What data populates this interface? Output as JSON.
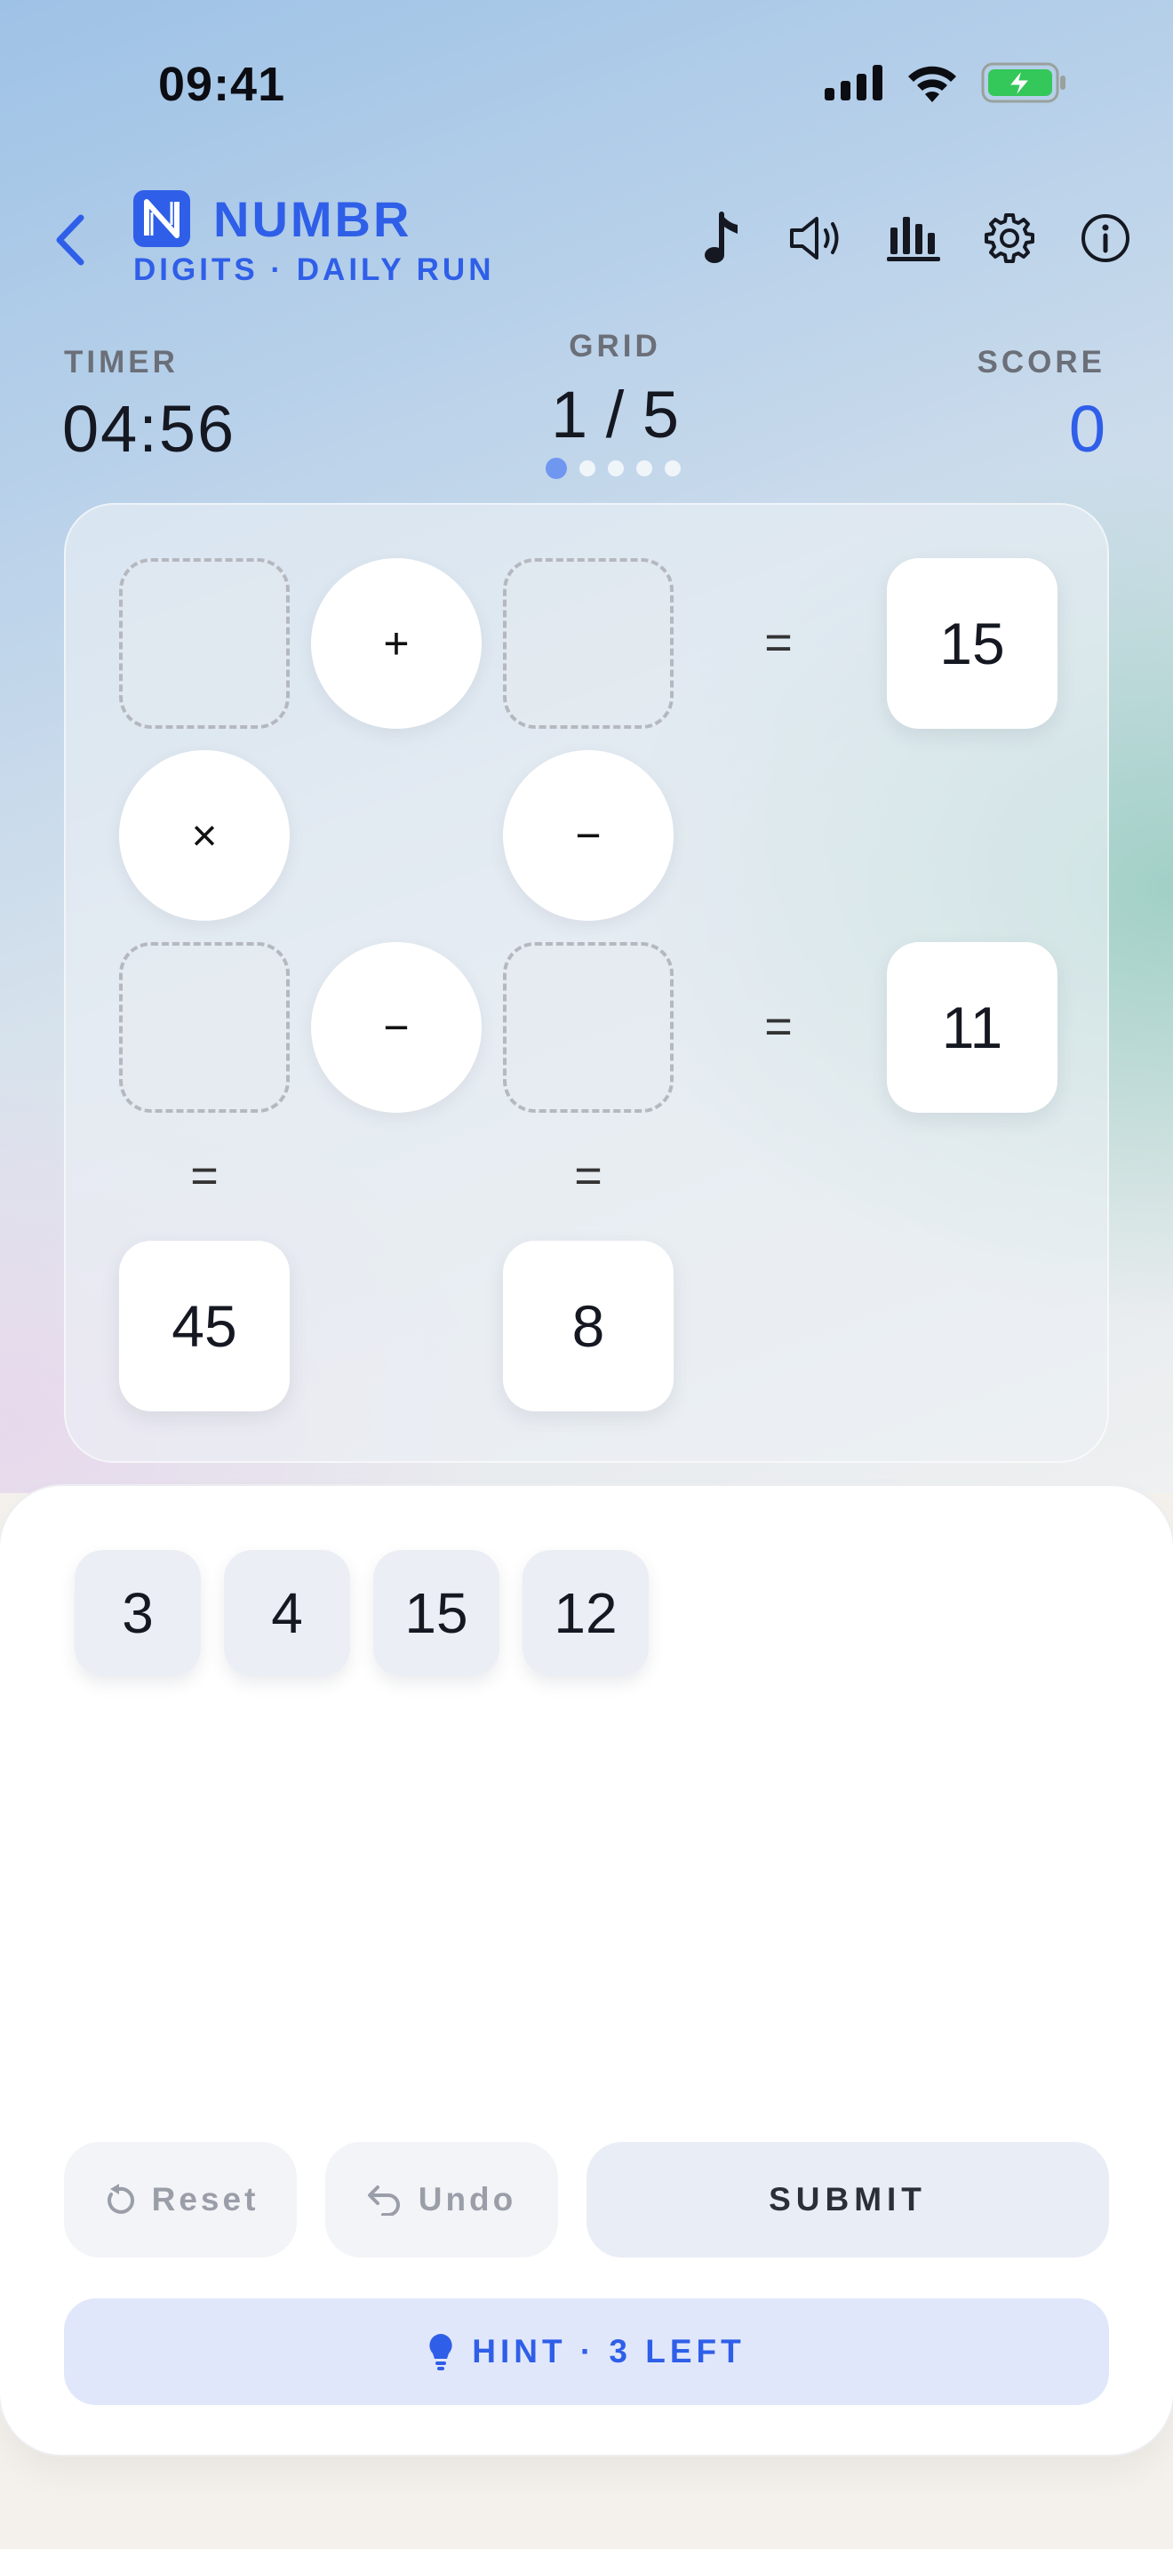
{
  "status_bar": {
    "time": "09:41"
  },
  "header": {
    "title": "NUMBR",
    "subtitle": "DIGITS · DAILY RUN",
    "icons": [
      "back-icon",
      "music-icon",
      "volume-icon",
      "stats-icon",
      "gear-icon",
      "info-icon"
    ]
  },
  "stats": {
    "timer_label": "TIMER",
    "timer_value": "04:56",
    "grid_label": "GRID",
    "grid_value": "1 / 5",
    "grid_progress": {
      "current": 1,
      "total": 5
    },
    "score_label": "SCORE",
    "score_value": "0"
  },
  "board": {
    "row1": {
      "op": "+",
      "eq": "=",
      "result": "15"
    },
    "col_ops": [
      "×",
      "−"
    ],
    "row2": {
      "op": "−",
      "eq": "=",
      "result": "11"
    },
    "col_eq": [
      "=",
      "="
    ],
    "col_results": [
      "45",
      "8"
    ]
  },
  "tiles": [
    "3",
    "4",
    "15",
    "12"
  ],
  "actions": {
    "reset": "Reset",
    "undo": "Undo",
    "submit": "SUBMIT",
    "hint": "HINT · 3 LEFT"
  },
  "colors": {
    "accent": "#2f5fe8",
    "battery": "#34c759"
  }
}
